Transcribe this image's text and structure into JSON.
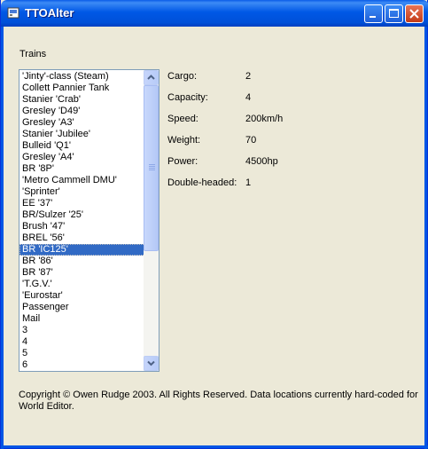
{
  "window": {
    "title": "TTOAlter"
  },
  "trains_label": "Trains",
  "trains_list": [
    "'Jinty'-class (Steam)",
    "Collett Pannier Tank",
    "Stanier 'Crab'",
    "Gresley 'D49'",
    "Gresley 'A3'",
    "Stanier 'Jubilee'",
    "Bulleid 'Q1'",
    "Gresley 'A4'",
    "BR '8P'",
    "'Metro Cammell DMU'",
    "'Sprinter'",
    "EE '37'",
    "BR/Sulzer '25'",
    "Brush '47'",
    "BREL '56'",
    "BR 'IC125'",
    "BR '86'",
    "BR '87'",
    "'T.G.V.'",
    "'Eurostar'",
    "Passenger",
    "Mail",
    "3",
    "4",
    "5",
    "6"
  ],
  "selected_index": 15,
  "properties": [
    {
      "label": "Cargo:",
      "value": "2"
    },
    {
      "label": "Capacity:",
      "value": "4"
    },
    {
      "label": "Speed:",
      "value": "200km/h"
    },
    {
      "label": "Weight:",
      "value": "70"
    },
    {
      "label": "Power:",
      "value": "4500hp"
    },
    {
      "label": "Double-headed:",
      "value": "1"
    }
  ],
  "footer": {
    "line1": "Copyright © Owen Rudge 2003. All Rights Reserved. Data locations currently hard-coded for",
    "line2": "World Editor."
  }
}
